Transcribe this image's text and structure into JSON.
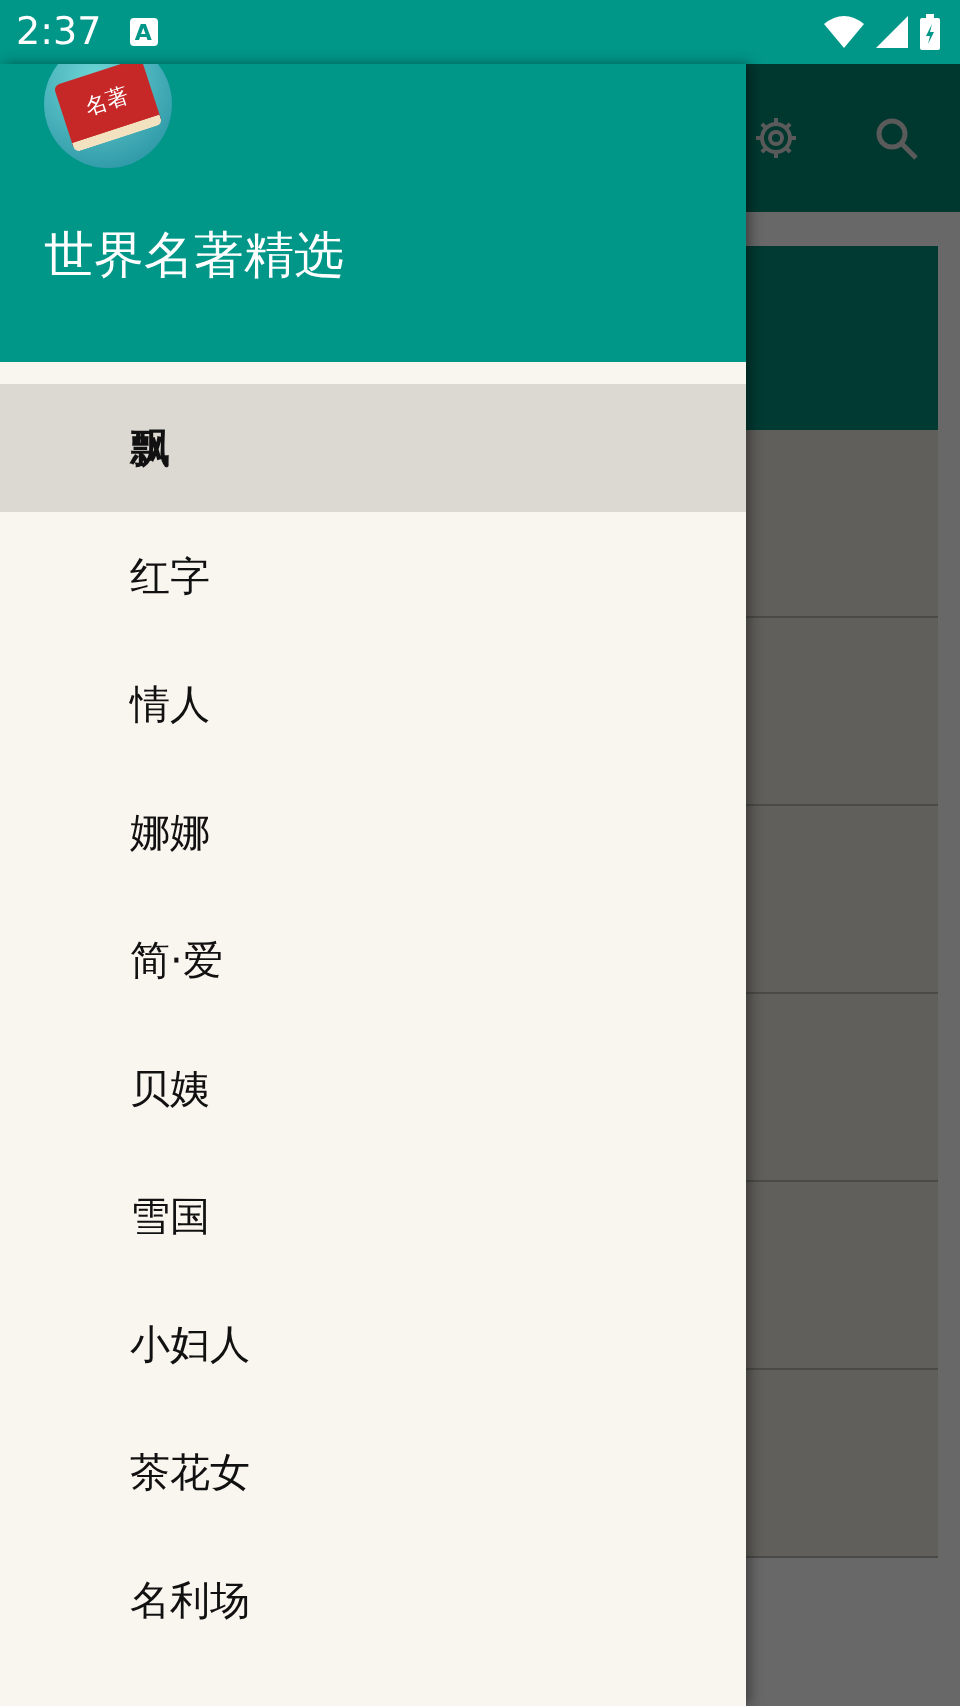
{
  "status_bar": {
    "time": "2:37",
    "notification": "A"
  },
  "drawer": {
    "logo_text": "名著",
    "title": "世界名著精选",
    "items": [
      {
        "label": "飘",
        "selected": true
      },
      {
        "label": "红字",
        "selected": false
      },
      {
        "label": "情人",
        "selected": false
      },
      {
        "label": "娜娜",
        "selected": false
      },
      {
        "label": "简·爱",
        "selected": false
      },
      {
        "label": "贝姨",
        "selected": false
      },
      {
        "label": "雪国",
        "selected": false
      },
      {
        "label": "小妇人",
        "selected": false
      },
      {
        "label": "茶花女",
        "selected": false
      },
      {
        "label": "名利场",
        "selected": false
      }
    ]
  }
}
